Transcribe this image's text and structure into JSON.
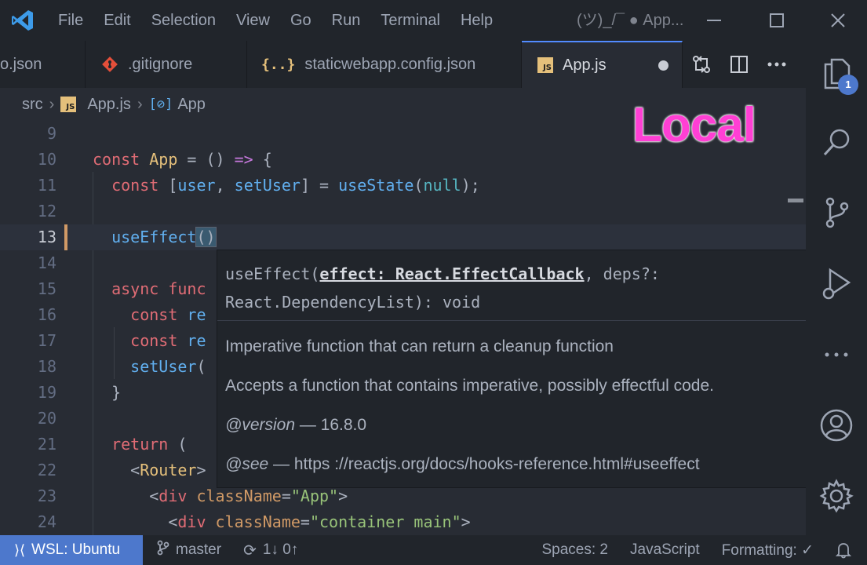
{
  "titlebar": {
    "menu": [
      "File",
      "Edit",
      "Selection",
      "View",
      "Go",
      "Run",
      "Terminal",
      "Help"
    ],
    "window_title": "(ツ)_/¯ ● App..."
  },
  "tabs": [
    {
      "label": "o.json",
      "icon": "json-icon"
    },
    {
      "label": ".gitignore",
      "icon": "git-icon"
    },
    {
      "label": "staticwebapp.config.json",
      "icon": "json-braces-icon"
    },
    {
      "label": "App.js",
      "icon": "js-icon",
      "active": true,
      "modified": true
    }
  ],
  "breadcrumb": {
    "folder": "src",
    "file": "App.js",
    "symbol": "App",
    "badge": "JS"
  },
  "overlay_label": "Local",
  "code_lines": [
    {
      "n": "9"
    },
    {
      "n": "10"
    },
    {
      "n": "11"
    },
    {
      "n": "12"
    },
    {
      "n": "13"
    },
    {
      "n": "14"
    },
    {
      "n": "15"
    },
    {
      "n": "16"
    },
    {
      "n": "17"
    },
    {
      "n": "18"
    },
    {
      "n": "19"
    },
    {
      "n": "20"
    },
    {
      "n": "21"
    },
    {
      "n": "22"
    },
    {
      "n": "23"
    },
    {
      "n": "24"
    }
  ],
  "code": {
    "l10": {
      "const": "const",
      "name": "App",
      "eq": " = () ",
      "arrow": "=>",
      "brace": " {"
    },
    "l11": {
      "const": "const",
      "open": " [",
      "user": "user",
      "comma": ", ",
      "setUser": "setUser",
      "close": "] = ",
      "useState": "useState",
      "paren": "(",
      "nul": "null",
      "end": ");"
    },
    "l13": {
      "fn": "useEffect",
      "paren": "()"
    },
    "l15": {
      "kw": "async",
      "rest": " func"
    },
    "l16": {
      "kw": "const",
      "rest": " re"
    },
    "l17": {
      "kw": "const",
      "rest": " re"
    },
    "l18": {
      "fn": "setUser",
      "rest": "("
    },
    "l19": {
      "text": "}"
    },
    "l21": {
      "kw": "return",
      "rest": " ("
    },
    "l22": {
      "open": "<",
      "tag": "Router",
      "close": ">"
    },
    "l23": {
      "open": "<",
      "tag": "div",
      "attr": " className",
      "eq": "=",
      "str": "\"App\"",
      "close": ">"
    },
    "l24": {
      "open": "<",
      "tag": "div",
      "attr": " className",
      "eq": "=",
      "str": "\"container main\"",
      "close": ">"
    }
  },
  "hover": {
    "sig_fn": "useEffect(",
    "sig_param": "effect: React.EffectCallback",
    "sig_rest": ", deps?:",
    "sig_line2": "React.DependencyList): void",
    "doc1": "Imperative function that can return a cleanup function",
    "doc2": "Accepts a function that contains imperative, possibly effectful code.",
    "version_tag": "@version",
    "version_val": " — 16.8.0",
    "see_tag": "@see",
    "see_val": " — https ://reactjs.org/docs/hooks-reference.html#useeffect"
  },
  "activity": {
    "explorer_badge": "1"
  },
  "statusbar": {
    "remote": "WSL: Ubuntu",
    "branch": "master",
    "sync": "1↓ 0↑",
    "spaces": "Spaces: 2",
    "language": "JavaScript",
    "formatting": "Formatting: ✓"
  },
  "colors": {
    "accent": "#4d78cc",
    "overlay": "#ff3fd4",
    "modified_gutter": "#d19a66"
  }
}
